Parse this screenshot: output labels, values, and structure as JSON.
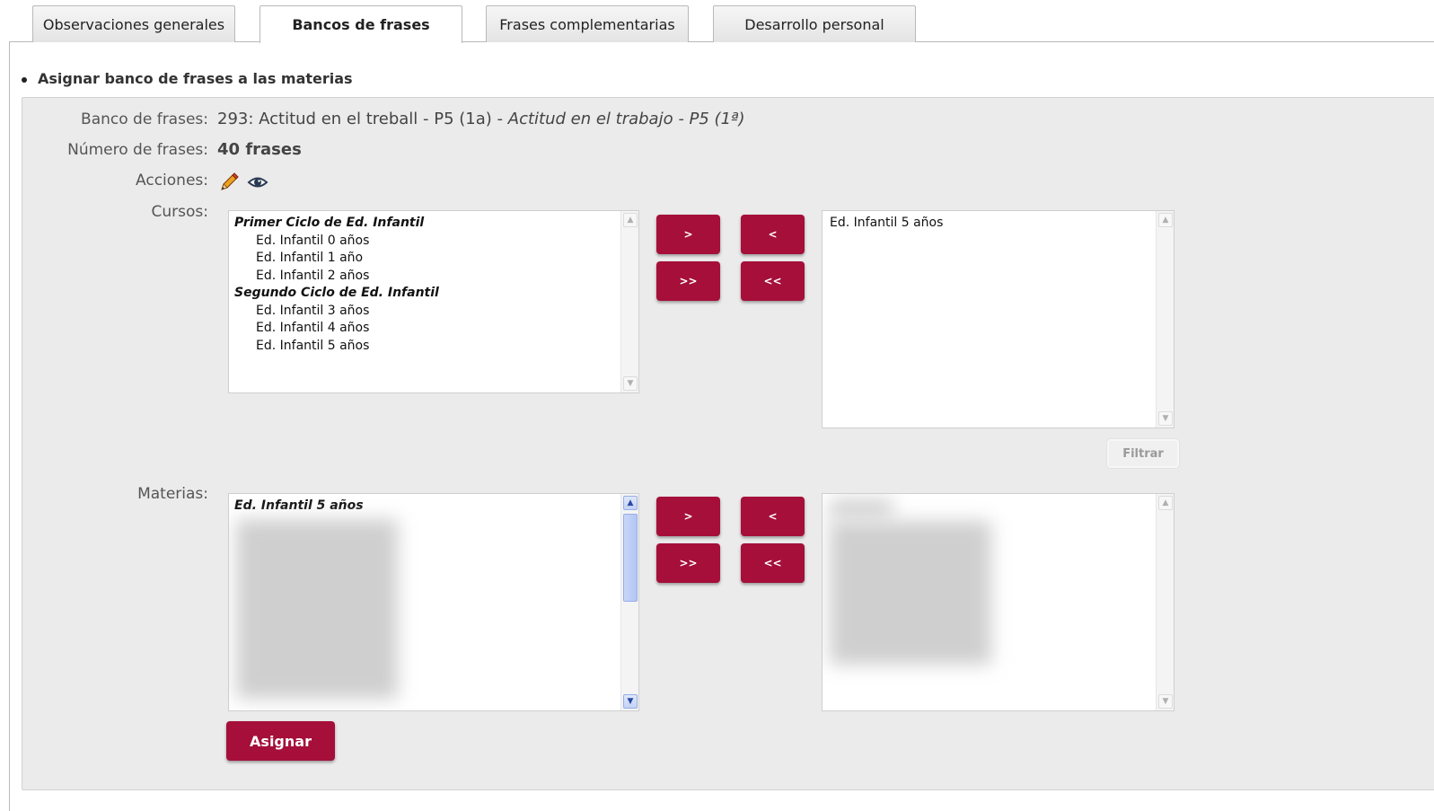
{
  "tabs": [
    {
      "label": "Observaciones generales",
      "active": false
    },
    {
      "label": "Bancos de frases",
      "active": true
    },
    {
      "label": "Frases complementarias",
      "active": false
    },
    {
      "label": "Desarrollo personal",
      "active": false
    }
  ],
  "section_title": "Asignar banco de frases a las materias",
  "fields": {
    "banco_label": "Banco de frases:",
    "banco_value_main": "293: Actitud en el treball - P5 (1a) -",
    "banco_value_italic": "Actitud en el trabajo - P5 (1ª)",
    "numero_label": "Número de frases:",
    "numero_value": "40 frases",
    "acciones_label": "Acciones:",
    "cursos_label": "Cursos:",
    "materias_label": "Materias:"
  },
  "icons": {
    "edit": "pencil-icon",
    "view": "eye-icon"
  },
  "cursos_available": {
    "groups": [
      {
        "label": "Primer Ciclo de Ed. Infantil",
        "options": [
          "Ed. Infantil 0 años",
          "Ed. Infantil 1 año",
          "Ed. Infantil 2 años"
        ]
      },
      {
        "label": "Segundo Ciclo de Ed. Infantil",
        "options": [
          "Ed. Infantil 3 años",
          "Ed. Infantil 4 años",
          "Ed. Infantil 5 años"
        ]
      }
    ]
  },
  "cursos_selected": [
    "Ed. Infantil 5 años"
  ],
  "materias_available_group": "Ed. Infantil 5 años",
  "transfer_buttons": {
    "add": ">",
    "remove": "<",
    "add_all": ">>",
    "remove_all": "<<"
  },
  "buttons": {
    "filtrar": "Filtrar",
    "asignar": "Asignar"
  },
  "colors": {
    "accent": "#a50f3a",
    "panel": "#ebebeb"
  }
}
